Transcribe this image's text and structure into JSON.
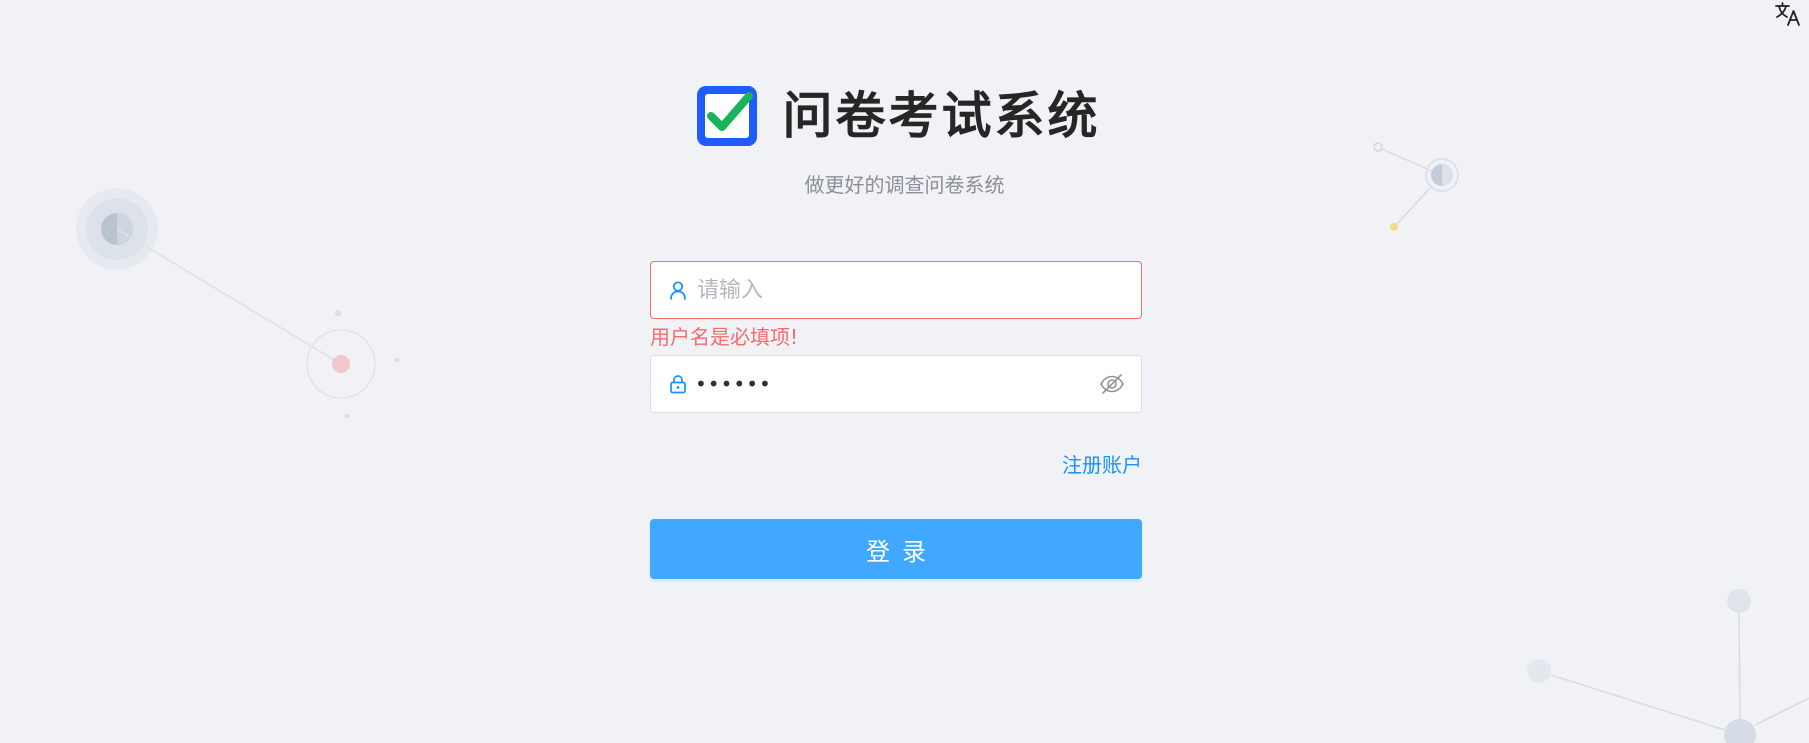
{
  "header": {
    "title": "问卷考试系统",
    "subtitle": "做更好的调查问卷系统"
  },
  "toolbar": {
    "translate_icon": "translate-icon"
  },
  "form": {
    "username": {
      "value": "",
      "placeholder": "请输入",
      "icon": "user-icon",
      "error": "用户名是必填项!"
    },
    "password": {
      "masked_value": "••••••",
      "icon": "lock-icon",
      "toggle_icon": "eye-off-icon"
    },
    "register_label": "注册账户",
    "login_label": "登录"
  },
  "colors": {
    "background": "#f0f2f5",
    "primary": "#40a9ff",
    "link": "#1890ff",
    "error": "#f56c6c",
    "logo_blue": "#1f5cff",
    "logo_green": "#19b35c"
  }
}
